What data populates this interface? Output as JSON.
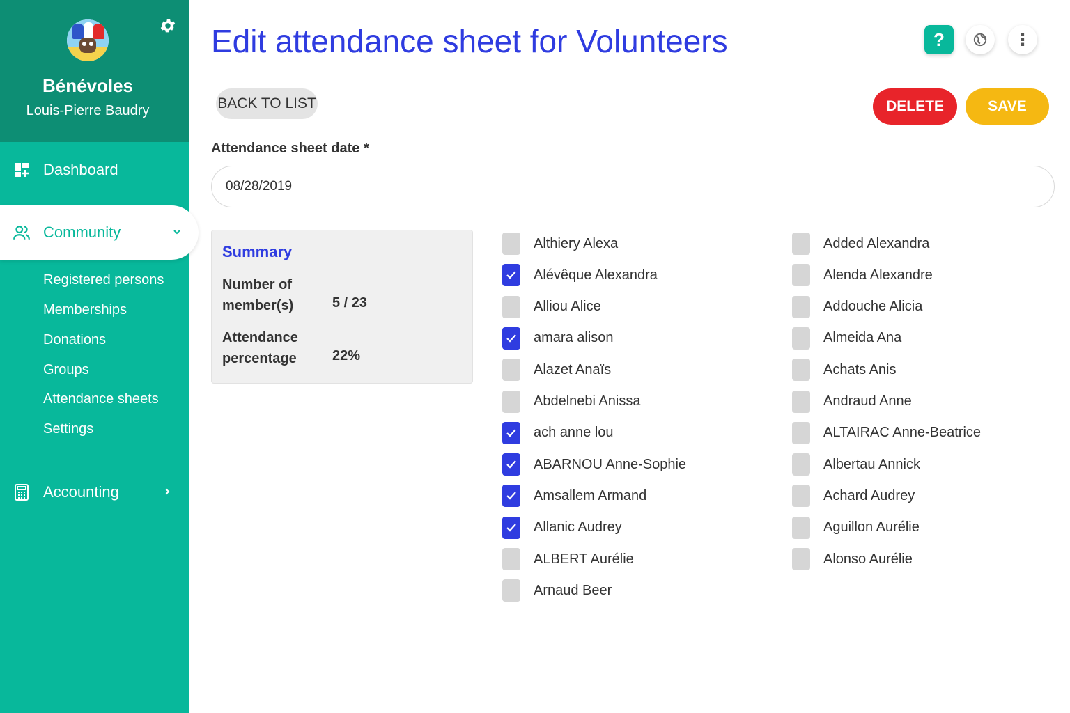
{
  "sidebar": {
    "org_name": "Bénévoles",
    "user_name": "Louis-Pierre Baudry",
    "nav": {
      "dashboard": "Dashboard",
      "community": "Community",
      "accounting": "Accounting"
    },
    "sub_items": [
      "Registered persons",
      "Memberships",
      "Donations",
      "Groups",
      "Attendance sheets",
      "Settings"
    ]
  },
  "header": {
    "title": "Edit attendance sheet for Volunteers",
    "help_glyph": "?",
    "more_glyph": "⋮"
  },
  "actions": {
    "back": "BACK TO LIST",
    "delete": "DELETE",
    "save": "SAVE"
  },
  "form": {
    "date_label": "Attendance sheet date *",
    "date_value": "08/28/2019"
  },
  "summary": {
    "title": "Summary",
    "members_label": "Number of member(s)",
    "members_value": "5 / 23",
    "percentage_label": "Attendance percentage",
    "percentage_value": "22%"
  },
  "members_left": [
    {
      "name": "Althiery Alexa",
      "checked": false
    },
    {
      "name": "Alévêque Alexandra",
      "checked": true
    },
    {
      "name": "Alliou Alice",
      "checked": false
    },
    {
      "name": "amara alison",
      "checked": true
    },
    {
      "name": "Alazet Anaïs",
      "checked": false
    },
    {
      "name": "Abdelnebi Anissa",
      "checked": false
    },
    {
      "name": "ach anne lou",
      "checked": true
    },
    {
      "name": "ABARNOU Anne-Sophie",
      "checked": true
    },
    {
      "name": "Amsallem Armand",
      "checked": true
    },
    {
      "name": "Allanic Audrey",
      "checked": true
    },
    {
      "name": "ALBERT Aurélie",
      "checked": false
    },
    {
      "name": "Arnaud Beer",
      "checked": false
    }
  ],
  "members_right": [
    {
      "name": "Added Alexandra",
      "checked": false
    },
    {
      "name": "Alenda Alexandre",
      "checked": false
    },
    {
      "name": "Addouche Alicia",
      "checked": false
    },
    {
      "name": "Almeida Ana",
      "checked": false
    },
    {
      "name": "Achats Anis",
      "checked": false
    },
    {
      "name": "Andraud Anne",
      "checked": false
    },
    {
      "name": "ALTAIRAC Anne-Beatrice",
      "checked": false
    },
    {
      "name": "Albertau Annick",
      "checked": false
    },
    {
      "name": "Achard Audrey",
      "checked": false
    },
    {
      "name": "Aguillon Aurélie",
      "checked": false
    },
    {
      "name": "Alonso Aurélie",
      "checked": false
    }
  ],
  "colors": {
    "sidebar": "#08b89b",
    "sidebar_header": "#0d8e74",
    "accent_blue": "#2f3ce0",
    "delete_red": "#e8242a",
    "save_yellow": "#f5b812"
  }
}
